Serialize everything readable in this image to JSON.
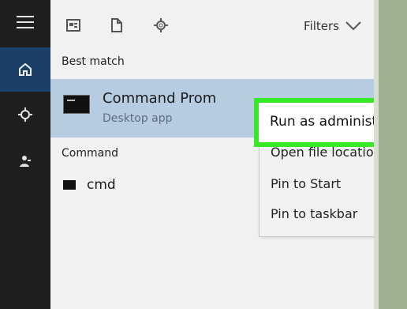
{
  "sidebar": {
    "items": [
      {
        "icon": "hamburger-icon"
      },
      {
        "icon": "home-icon"
      },
      {
        "icon": "settings-icon"
      },
      {
        "icon": "user-icon"
      }
    ]
  },
  "toolbar": {
    "icons": [
      "document-icon",
      "file-icon",
      "gear-icon"
    ],
    "filters_label": "Filters"
  },
  "main": {
    "best_match_label": "Best match",
    "best_match_title": "Command Prom",
    "best_match_subtitle": "Desktop app",
    "command_label": "Command",
    "command_item": "cmd"
  },
  "context_menu": {
    "items": [
      "Run as administrator",
      "Open file location",
      "Pin to Start",
      "Pin to taskbar"
    ]
  },
  "colors": {
    "highlight_border": "#37e826",
    "selected_row": "#b6cce0",
    "rail_active": "#1b3f66"
  }
}
